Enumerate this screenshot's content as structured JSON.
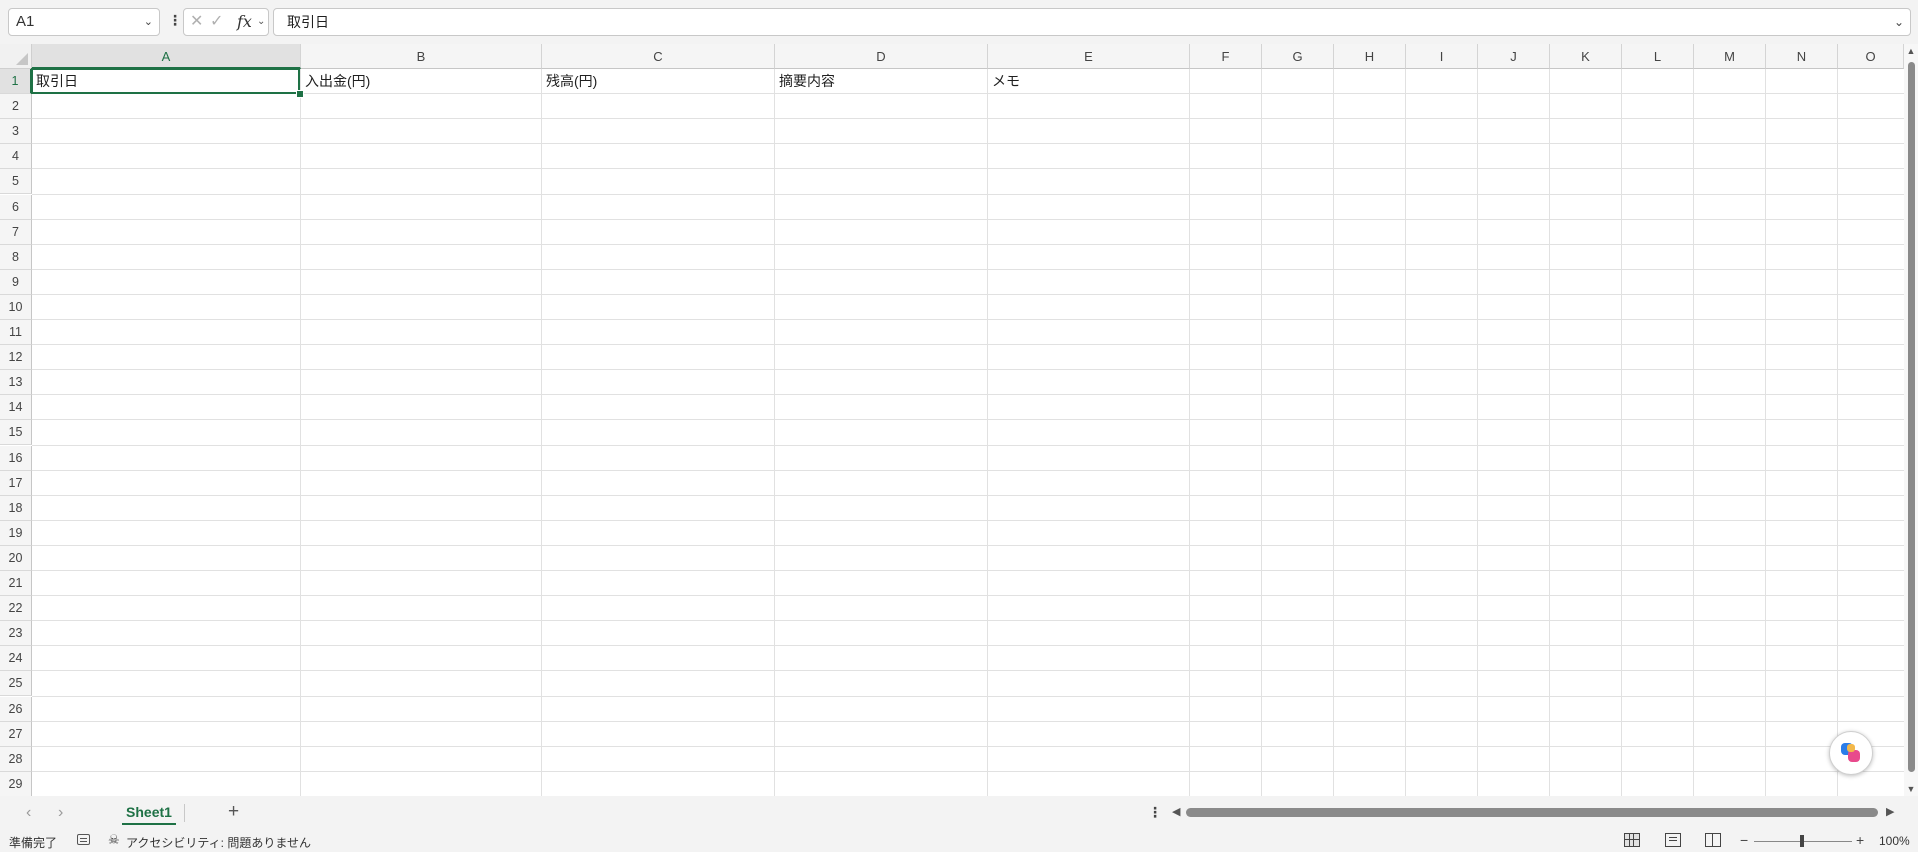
{
  "formula_bar": {
    "name_box": "A1",
    "cancel_icon": "✕",
    "enter_icon": "✓",
    "fx_label": "fx",
    "content": "取引日"
  },
  "columns": [
    "A",
    "B",
    "C",
    "D",
    "E",
    "F",
    "G",
    "H",
    "I",
    "J",
    "K",
    "L",
    "M",
    "N",
    "O"
  ],
  "rows": [
    "1",
    "2",
    "3",
    "4",
    "5",
    "6",
    "7",
    "8",
    "9",
    "10",
    "11",
    "12",
    "13",
    "14",
    "15",
    "16",
    "17",
    "18",
    "19",
    "20",
    "21",
    "22",
    "23",
    "24",
    "25",
    "26",
    "27",
    "28",
    "29"
  ],
  "cells": {
    "A1": "取引日",
    "B1": "入出金(円)",
    "C1": "残高(円)",
    "D1": "摘要内容",
    "E1": "メモ"
  },
  "active_cell": "A1",
  "sheets": [
    {
      "name": "Sheet1",
      "active": true
    }
  ],
  "status": {
    "ready": "準備完了",
    "accessibility": "アクセシビリティ: 問題ありません",
    "zoom": "100%"
  },
  "colors": {
    "accent": "#1e7145",
    "gridline": "#e1e1e1",
    "header_bg": "#f5f5f5"
  },
  "icons": {
    "add_sheet": "plus-icon",
    "copilot": "copilot-icon",
    "accessibility": "accessibility-icon",
    "macro": "macro-recording-icon"
  }
}
